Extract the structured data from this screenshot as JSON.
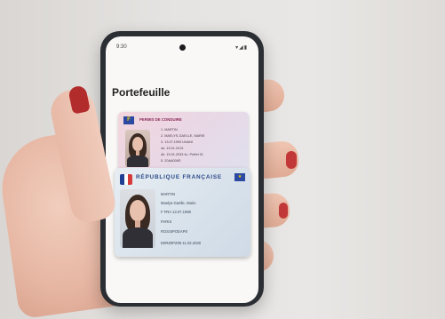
{
  "phone": {
    "status_time": "9:30",
    "status_icons": "▾◢▮",
    "wallet_title": "Portefeuille"
  },
  "license_card": {
    "flag_letter": "F",
    "title": "PERMIS DE CONDUIRE",
    "fields": [
      "1. MARTIN",
      "2. MAELYS-GAELLE, MARIE",
      "3. 13.07.1990 UNANI",
      "4a. 19.01.2019",
      "4b. 19.01.2033   4c. Préfet 01",
      "5. 20AA008S"
    ]
  },
  "id_card": {
    "title": "RÉPUBLIQUE FRANÇAISE",
    "fields": [
      "MARTIN",
      "Maelys-Gaëlle, Marie",
      "F      FRA      13.07.1990",
      "PARIS",
      "ROSSIPOEAP8",
      "D0RZ0PZ09        11.02.2030"
    ]
  },
  "colors": {
    "nail": "#b32c2c",
    "phone_frame": "#2b2e33",
    "id_blue": "#2b4a8a",
    "license_pink": "#f2d6dc"
  }
}
